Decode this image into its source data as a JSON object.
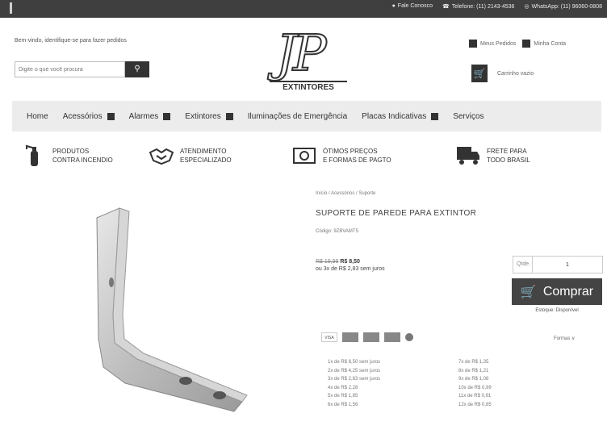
{
  "topbar": {
    "links": [
      {
        "icon": "chat-icon",
        "label": "Fale Conosco"
      },
      {
        "icon": "phone-icon",
        "label": "Telefone: (11) 2143-4536"
      },
      {
        "icon": "whatsapp-icon",
        "label": "WhatsApp: (11) 96060-0808"
      }
    ]
  },
  "header": {
    "welcome": "Bem-vindo, identifique-se para fazer pedidos",
    "search_placeholder": "Digite o que você procura",
    "logo_text": "JP",
    "logo_sub": "EXTINTORES",
    "account": {
      "orders": "Meus Pedidos",
      "my_account": "Minha Conta"
    },
    "cart": "Carrinho vazio"
  },
  "nav": {
    "items": [
      {
        "label": "Home",
        "has_menu": false
      },
      {
        "label": "Acessórios",
        "has_menu": true
      },
      {
        "label": "Alarmes",
        "has_menu": true
      },
      {
        "label": "Extintores",
        "has_menu": true
      },
      {
        "label": "Iluminações de Emergência",
        "has_menu": false
      },
      {
        "label": "Placas Indicativas",
        "has_menu": true
      },
      {
        "label": "Serviços",
        "has_menu": false
      }
    ]
  },
  "features": [
    {
      "icon": "fire-extinguisher-icon",
      "line1": "PRODUTOS",
      "line2": "CONTRA INCENDIO"
    },
    {
      "icon": "handshake-icon",
      "line1": "ATENDIMENTO",
      "line2": "ESPECIALIZADO"
    },
    {
      "icon": "money-icon",
      "line1": "ÓTIMOS PREÇOS",
      "line2": "E FORMAS DE PAGTO"
    },
    {
      "icon": "truck-icon",
      "line1": "FRETE PARA",
      "line2": "TODO BRASIL"
    }
  ],
  "product": {
    "breadcrumb": "Início / Acessórios / Suporte",
    "title": "SUPORTE DE PAREDE PARA EXTINTOR",
    "code": "Código: 9ZBVAMT5",
    "old_price": "R$ 19,99",
    "new_price": "R$ 8,50",
    "installment": "ou 3x de R$ 2,83 sem juros",
    "qty_label": "Qtde.",
    "qty_value": "1",
    "buy_label": "Comprar",
    "stock": "Estoque: Disponível",
    "payment_label": "Formas",
    "installments_left": [
      "1x de R$ 8,50 sem juros",
      "2x de R$ 4,25 sem juros",
      "3x de R$ 2,83 sem juros",
      "4x de R$ 2,28",
      "5x de R$ 1,85",
      "6x de R$ 1,56"
    ],
    "installments_right": [
      "7x de R$ 1,35",
      "8x de R$ 1,21",
      "9x de R$ 1,08",
      "10x de R$ 0,99",
      "11x de R$ 0,91",
      "12x de R$ 0,85"
    ]
  }
}
